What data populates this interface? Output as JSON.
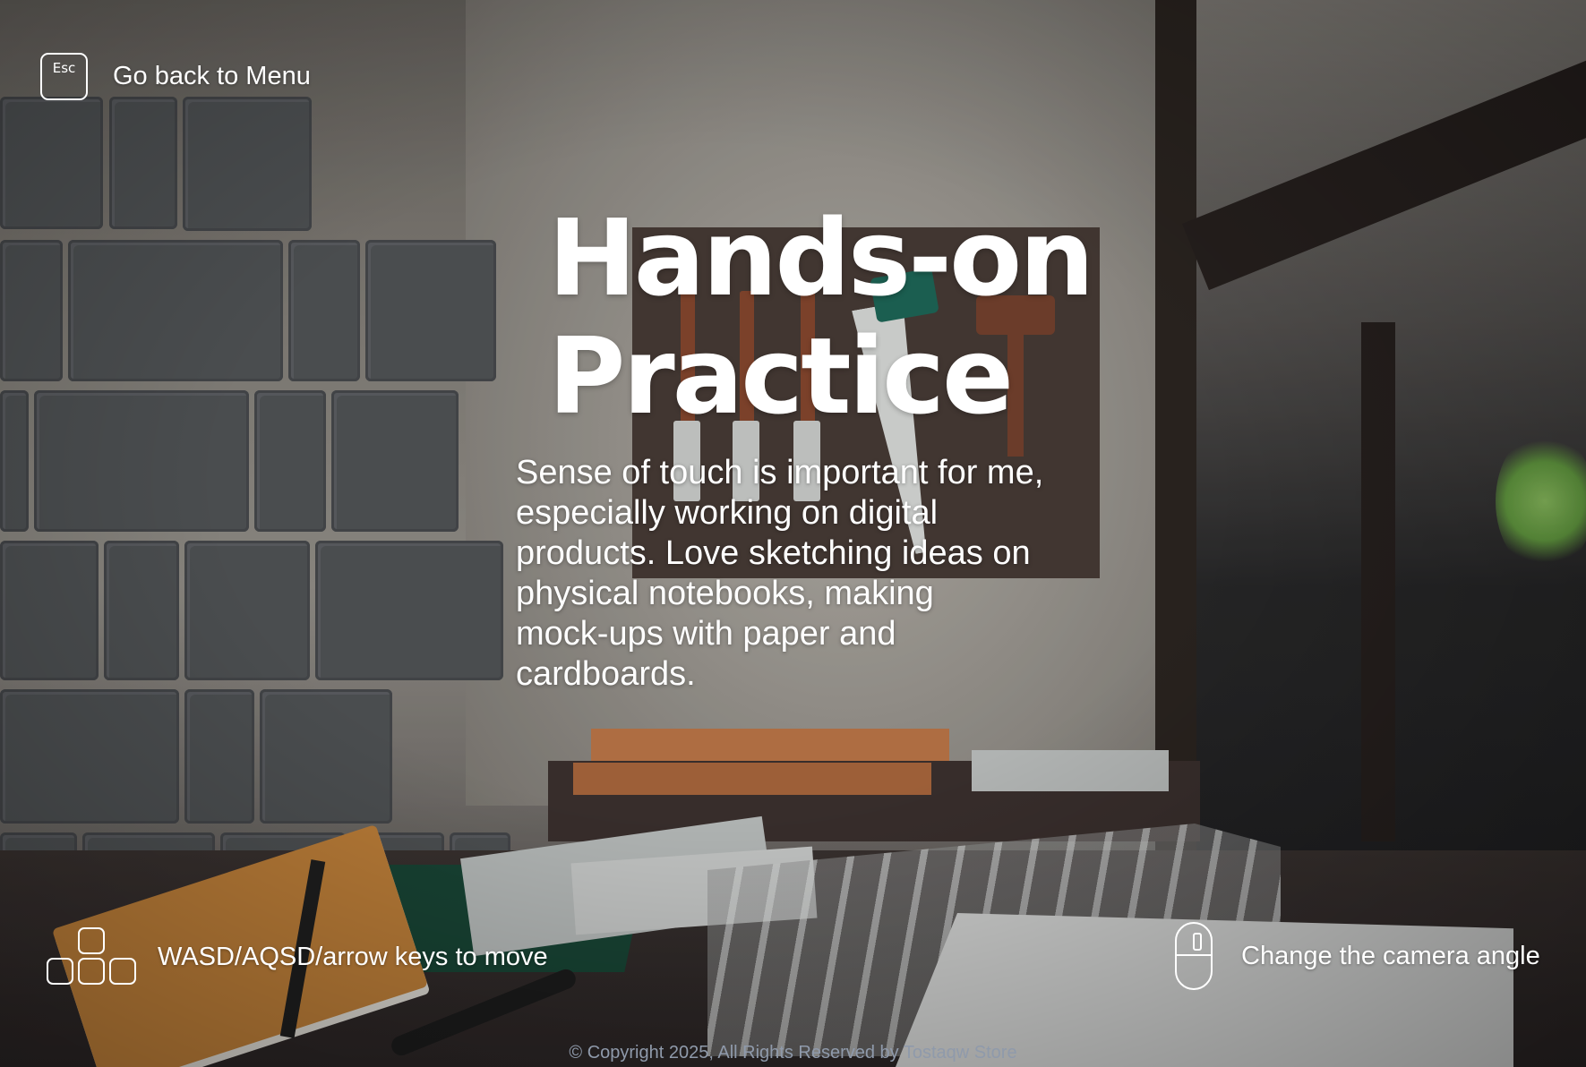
{
  "hud": {
    "esc_key": "Esc",
    "back_label": "Go back to Menu",
    "move_label": "WASD/AQSD/arrow keys to move",
    "camera_label": "Change the camera angle"
  },
  "section": {
    "title_line1": "Hands-on",
    "title_line2": "Practice",
    "description_lines": [
      "Sense of touch is important for me,",
      "especially working on digital",
      "products. Love sketching ideas on",
      "physical notebooks, making",
      "mock-ups with paper and",
      "cardboards."
    ]
  },
  "footer": {
    "copyright": "© Copyright 2025, All Rights Reserved by Tostaqw Store"
  },
  "icons": {
    "esc": "esc-key-icon",
    "keys": "keyboard-keys-icon",
    "mouse": "mouse-icon"
  },
  "colors": {
    "text": "#ffffff",
    "copyright": "#8f9aab"
  }
}
